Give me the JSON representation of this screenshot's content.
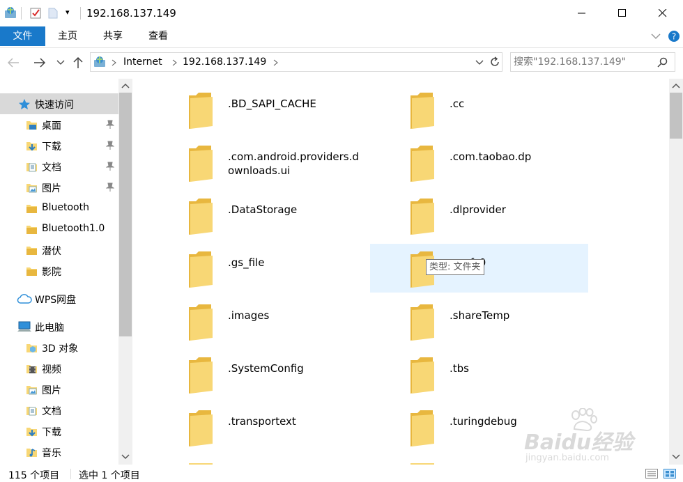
{
  "window": {
    "title": "192.168.137.149",
    "quick_access_more": "▾"
  },
  "ribbon": {
    "tabs": [
      "文件",
      "主页",
      "共享",
      "查看"
    ]
  },
  "address": {
    "crumbs": [
      "Internet",
      "192.168.137.149"
    ],
    "search_placeholder": "搜索\"192.168.137.149\""
  },
  "nav": {
    "items": [
      {
        "label": "快速访问",
        "icon": "star-icon",
        "pinned": false
      },
      {
        "label": "桌面",
        "icon": "desktop-folder-icon",
        "pinned": true
      },
      {
        "label": "下载",
        "icon": "download-folder-icon",
        "pinned": true
      },
      {
        "label": "文档",
        "icon": "document-folder-icon",
        "pinned": true
      },
      {
        "label": "图片",
        "icon": "picture-folder-icon",
        "pinned": true
      },
      {
        "label": "Bluetooth",
        "icon": "folder-icon",
        "pinned": false
      },
      {
        "label": "Bluetooth1.0",
        "icon": "folder-icon",
        "pinned": false
      },
      {
        "label": "潜伏",
        "icon": "folder-icon",
        "pinned": false
      },
      {
        "label": "影院",
        "icon": "folder-icon",
        "pinned": false
      },
      {
        "label": "WPS网盘",
        "icon": "cloud-icon",
        "pinned": false
      },
      {
        "label": "此电脑",
        "icon": "computer-icon",
        "pinned": false
      },
      {
        "label": "3D 对象",
        "icon": "3d-objects-icon",
        "pinned": false
      },
      {
        "label": "视频",
        "icon": "video-folder-icon",
        "pinned": false
      },
      {
        "label": "图片",
        "icon": "picture-folder-icon",
        "pinned": false
      },
      {
        "label": "文档",
        "icon": "document-folder-icon",
        "pinned": false
      },
      {
        "label": "下载",
        "icon": "download-folder-icon",
        "pinned": false
      },
      {
        "label": "音乐",
        "icon": "music-folder-icon",
        "pinned": false
      }
    ]
  },
  "folders": [
    ".BD_SAPI_CACHE",
    ".cc",
    ".com.android.providers.downloads.ui",
    ".com.taobao.dp",
    ".DataStorage",
    ".dlprovider",
    ".gs_file",
    ".gs_fs0",
    ".images",
    ".shareTemp",
    ".SystemConfig",
    ".tbs",
    ".transportext",
    ".turingdebug"
  ],
  "tooltip": "类型: 文件夹",
  "status": {
    "count": "115 个项目",
    "selected": "选中 1 个项目"
  },
  "watermark": {
    "brand": "Baidu经验",
    "url": "jingyan.baidu.com"
  },
  "colors": {
    "accent": "#1979ca",
    "selection": "#e5f3ff",
    "folder": "#f8d775",
    "folder_dark": "#e8b73f"
  }
}
